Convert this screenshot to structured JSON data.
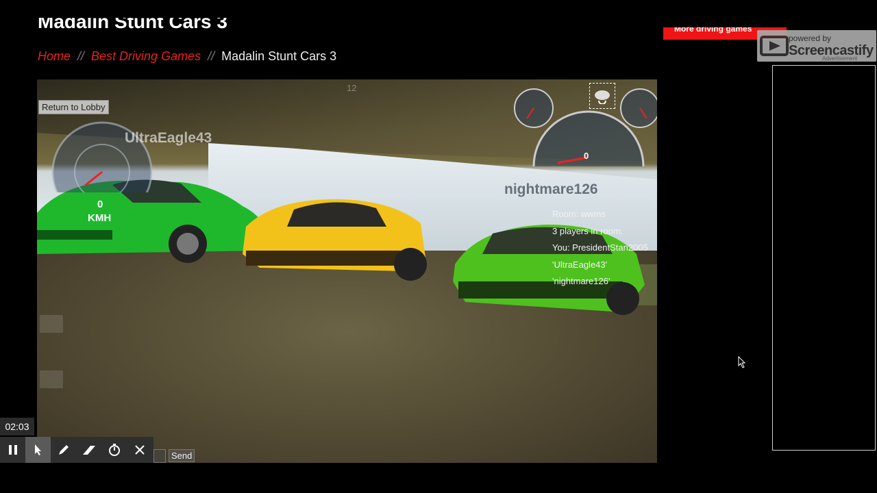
{
  "page": {
    "title": "Madalin Stunt Cars 3",
    "breadcrumb": {
      "home": "Home",
      "separator": "//",
      "category": "Best Driving Games",
      "current": "Madalin Stunt Cars 3"
    },
    "more_games_button": "More driving games"
  },
  "recorder_overlay": {
    "powered_by": "powered by",
    "brand": "Screencastify",
    "advertisement_label": "Advertisement",
    "elapsed_time": "02:03",
    "tools": [
      "pause-icon",
      "pointer-icon",
      "pen-icon",
      "eraser-icon",
      "timer-icon",
      "close-icon"
    ]
  },
  "game": {
    "return_to_lobby": "Return to Lobby",
    "hud": {
      "speed": "0",
      "speed_unit": "KMH",
      "gear": "0",
      "top_counter": "12"
    },
    "player_tags": [
      "UltraEagle43",
      "nightmare126"
    ],
    "room_info": [
      "Room: wwms",
      "3 players in room.",
      "You: PresidentStan2005",
      "'UltraEagle43'",
      "'nightmare126'"
    ],
    "chat_send": "Send"
  },
  "colors": {
    "accent_red": "#e8231b",
    "background": "#000000"
  }
}
